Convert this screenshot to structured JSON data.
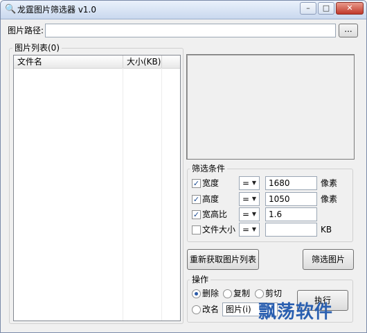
{
  "window": {
    "title": "龙霆图片筛选器 v1.0",
    "icon": "magnifier-icon"
  },
  "title_buttons": {
    "minimize": "–",
    "maximize": "□",
    "close": "✕"
  },
  "path": {
    "label": "图片路径:",
    "value": "",
    "browse_label": "..."
  },
  "list": {
    "group_label": "图片列表(0)",
    "columns": [
      "文件名",
      "大小(KB)"
    ],
    "rows": []
  },
  "filter": {
    "group_label": "筛选条件",
    "rows": [
      {
        "label": "宽度",
        "checked": true,
        "operator": "=",
        "value": "1680",
        "unit": "像素"
      },
      {
        "label": "高度",
        "checked": true,
        "operator": "=",
        "value": "1050",
        "unit": "像素"
      },
      {
        "label": "宽高比",
        "checked": true,
        "operator": "=",
        "value": "1.6",
        "unit": ""
      },
      {
        "label": "文件大小",
        "checked": false,
        "operator": "=",
        "value": "",
        "unit": "KB"
      }
    ]
  },
  "buttons": {
    "refresh": "重新获取图片列表",
    "filter": "筛选图片",
    "execute": "执行"
  },
  "operation": {
    "group_label": "操作",
    "options": [
      {
        "label": "删除",
        "selected": true
      },
      {
        "label": "复制",
        "selected": false
      },
      {
        "label": "剪切",
        "selected": false
      },
      {
        "label": "改名",
        "selected": false
      }
    ],
    "rename_value": "图片(i)"
  },
  "watermark": "飘荡软件"
}
